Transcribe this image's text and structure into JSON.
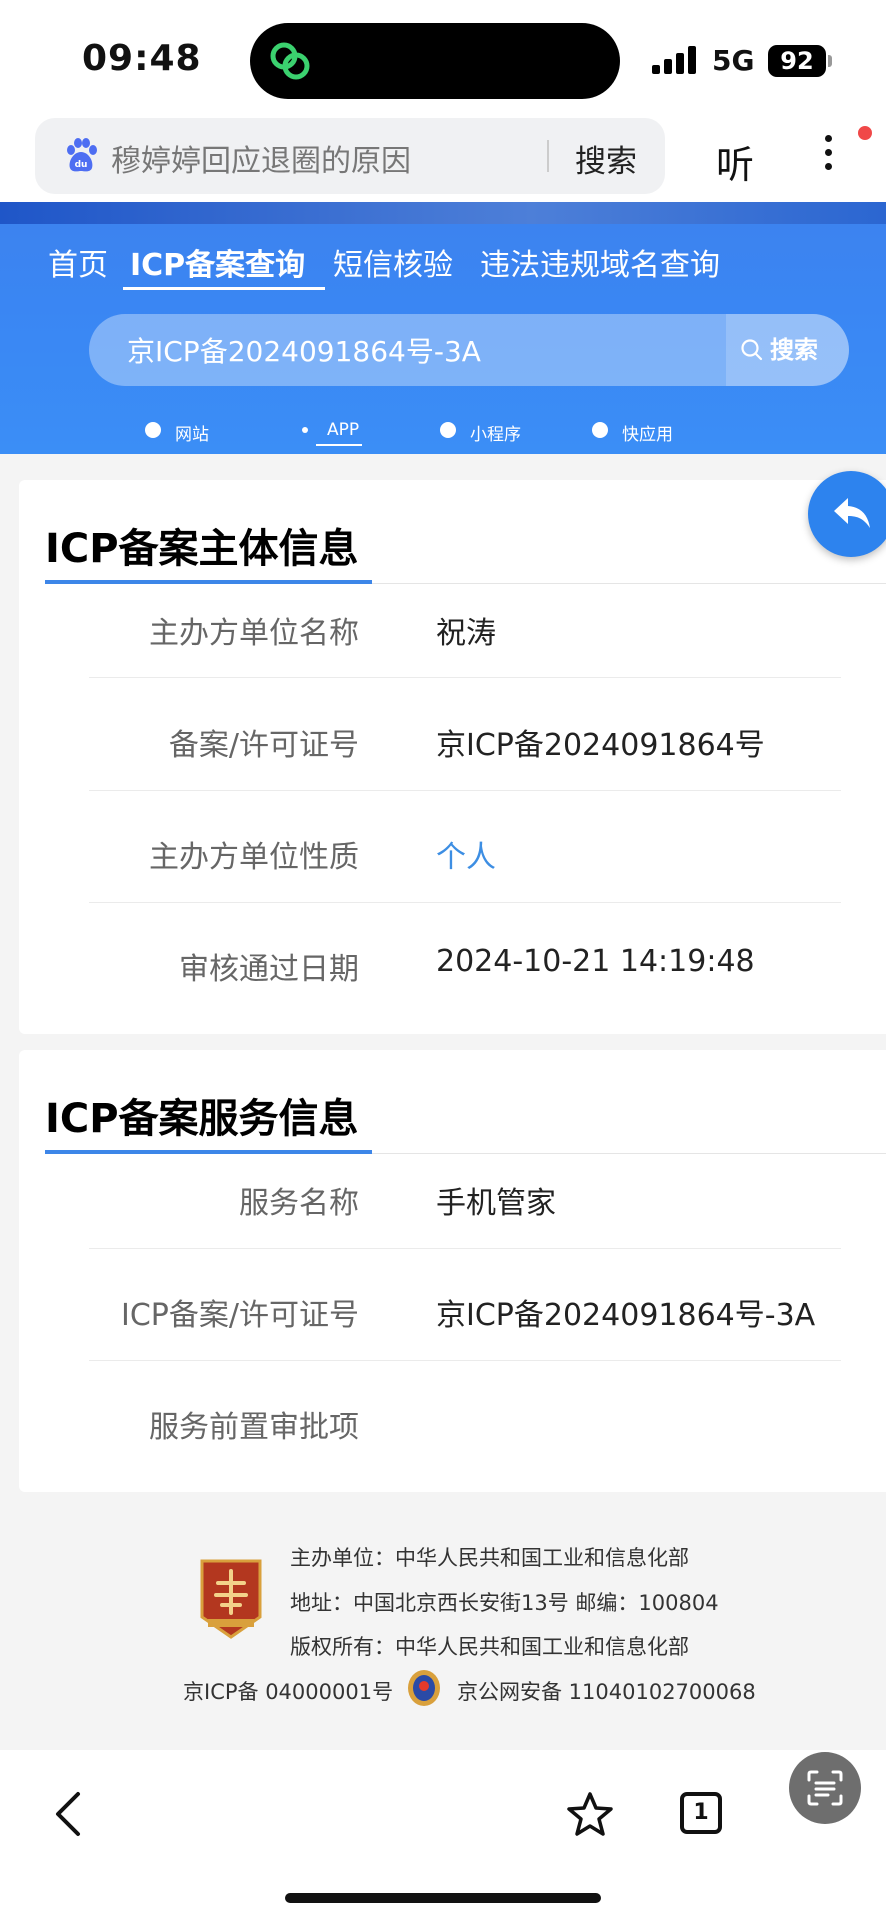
{
  "status_bar": {
    "time": "09:48",
    "network": "5G",
    "battery": "92"
  },
  "browser": {
    "search_query": "穆婷婷回应退圈的原因",
    "search_button": "搜索",
    "listen_button": "听"
  },
  "header": {
    "nav": [
      "首页",
      "ICP备案查询",
      "短信核验",
      "违法违规域名查询"
    ],
    "query_value": "京ICP备2024091864号-3A",
    "query_button": "搜索",
    "radio_options": [
      "网站",
      "APP",
      "小程序",
      "快应用"
    ],
    "selected_option": "APP"
  },
  "entity_info": {
    "title": "ICP备案主体信息",
    "rows": [
      {
        "label": "主办方单位名称",
        "value": "祝涛"
      },
      {
        "label": "备案/许可证号",
        "value": "京ICP备2024091864号"
      },
      {
        "label": "主办方单位性质",
        "value": "个人"
      },
      {
        "label": "审核通过日期",
        "value": "2024-10-21 14:19:48"
      }
    ]
  },
  "service_info": {
    "title": "ICP备案服务信息",
    "rows": [
      {
        "label": "服务名称",
        "value": "手机管家"
      },
      {
        "label": "ICP备案/许可证号",
        "value": "京ICP备2024091864号-3A"
      },
      {
        "label": "服务前置审批项",
        "value": ""
      }
    ]
  },
  "footer": {
    "lines": [
      "主办单位：中华人民共和国工业和信息化部",
      "地址：中国北京西长安街13号 邮编：100804",
      "版权所有：中华人民共和国工业和信息化部"
    ],
    "icp": "京ICP备 04000001号",
    "police": "京公网安备 11040102700068"
  },
  "bottom_bar": {
    "tab_count": "1"
  },
  "colors": {
    "accent_blue": "#3b8ef6",
    "link_blue": "#3d8ee3",
    "fab_blue": "#2d83ee"
  }
}
